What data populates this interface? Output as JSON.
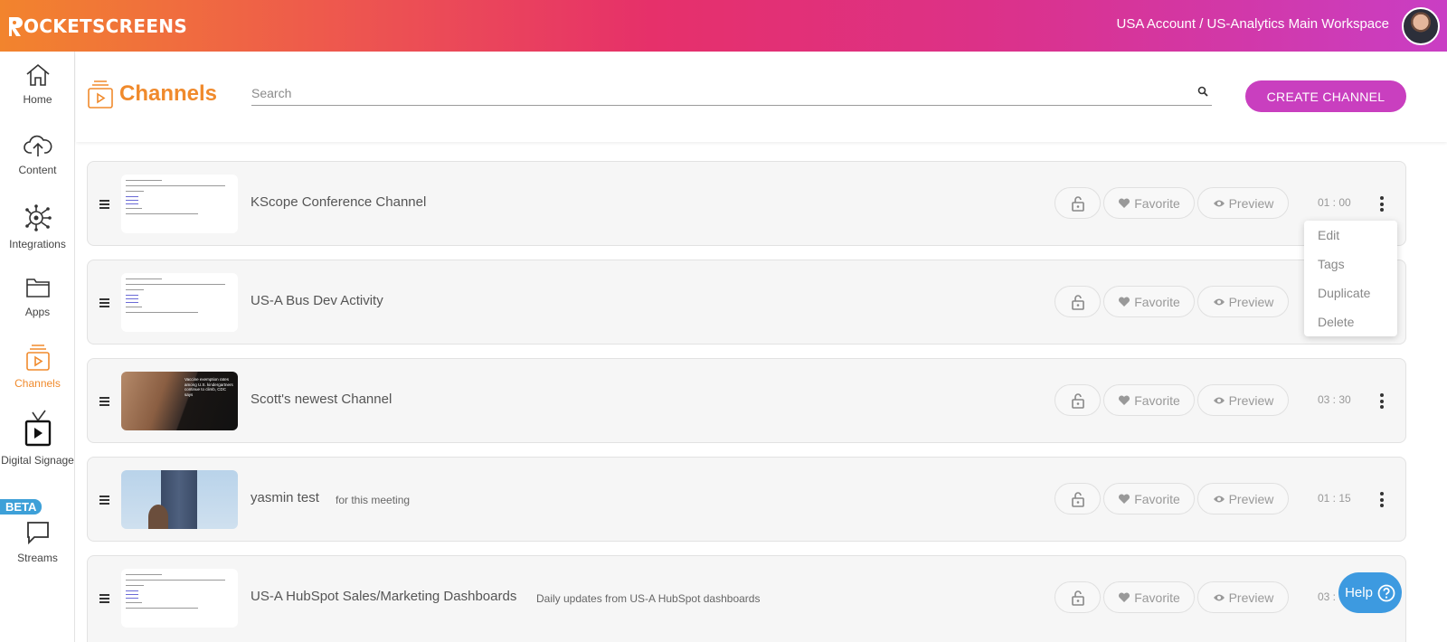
{
  "app": {
    "logo_text": "OCKETSCREENS",
    "logo_initial": "R"
  },
  "header": {
    "account": "USA Account / US-Analytics Main Workspace"
  },
  "sidebar": {
    "items": [
      {
        "label": "Home",
        "icon": "home-icon"
      },
      {
        "label": "Content",
        "icon": "cloud-upload-icon"
      },
      {
        "label": "Integrations",
        "icon": "integrations-icon"
      },
      {
        "label": "Apps",
        "icon": "folder-icon"
      },
      {
        "label": "Channels",
        "icon": "channels-icon",
        "active": true
      },
      {
        "label": "Digital Signage",
        "icon": "tv-icon"
      },
      {
        "label": "Streams",
        "icon": "chat-icon",
        "badge": "BETA"
      }
    ]
  },
  "page": {
    "title": "Channels",
    "search_placeholder": "Search",
    "create_label": "CREATE CHANNEL"
  },
  "buttons": {
    "favorite": "Favorite",
    "preview": "Preview"
  },
  "channels": [
    {
      "title": "KScope Conference Channel",
      "desc": "",
      "duration": "01 : 00",
      "thumb": "document"
    },
    {
      "title": "US-A Bus Dev Activity",
      "desc": "",
      "duration": "",
      "thumb": "document"
    },
    {
      "title": "Scott's newest Channel",
      "desc": "",
      "duration": "03 : 30",
      "thumb": "vaccine"
    },
    {
      "title": "yasmin test",
      "desc": "for this meeting",
      "duration": "01 : 15",
      "thumb": "person"
    },
    {
      "title": "US-A HubSpot Sales/Marketing Dashboards",
      "desc": "Daily updates from US-A HubSpot dashboards",
      "duration": "03 :",
      "thumb": "document"
    }
  ],
  "thumb_text": "Vaccine exemption rates among U.S. kindergartners continue to climb, CDC says",
  "context_menu": [
    "Edit",
    "Tags",
    "Duplicate",
    "Delete"
  ],
  "help": {
    "label": "Help"
  },
  "colors": {
    "brand_orange": "#f08a2c",
    "brand_magenta": "#c93fbf",
    "help_blue": "#3d9ae0"
  }
}
